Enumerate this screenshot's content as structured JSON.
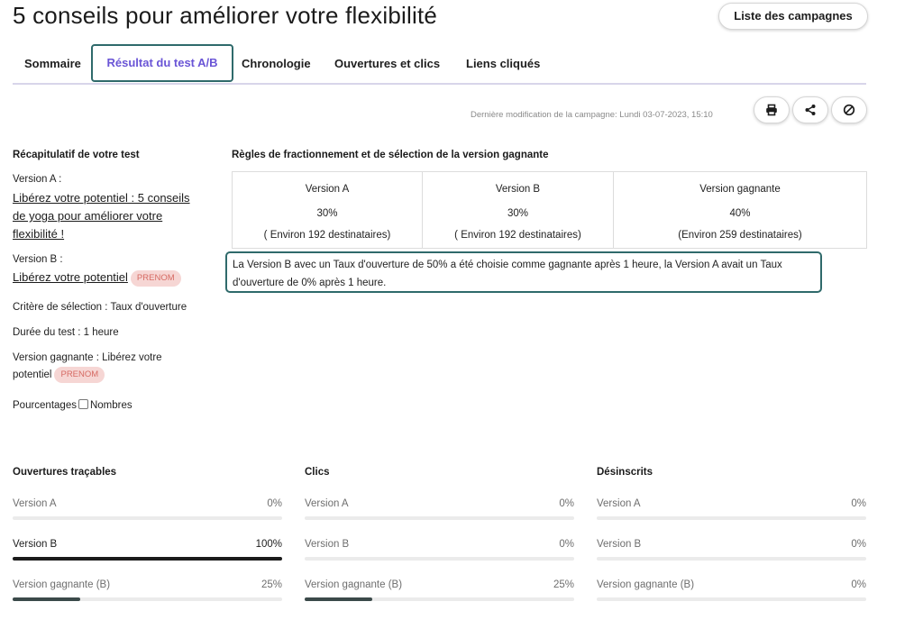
{
  "page": {
    "title": "5 conseils pour améliorer votre flexibilité",
    "campaigns_button": "Liste des campagnes"
  },
  "tabs": [
    {
      "label": "Sommaire",
      "active": false
    },
    {
      "label": "Résultat du test A/B",
      "active": true
    },
    {
      "label": "Chronologie",
      "active": false
    },
    {
      "label": "Ouvertures et clics",
      "active": false
    },
    {
      "label": "Liens cliqués",
      "active": false
    }
  ],
  "toolbar": {
    "last_modified_label": "Dernière modification de la campagne:",
    "last_modified_value": "Lundi 03-07-2023, 15:10",
    "icons": [
      "print-icon",
      "share-icon",
      "block-icon"
    ]
  },
  "summary": {
    "heading": "Récapitulatif de votre test",
    "version_a_label": "Version A :",
    "version_a_title_l1": "Libérez votre potentiel : 5 conseils",
    "version_a_title_l2": "de yoga pour améliorer votre",
    "version_a_title_l3": "flexibilité !",
    "version_b_label": "Version B :",
    "version_b_title": "Libérez votre potentiel",
    "badge": "PRENOM",
    "criteria": "Critère de sélection : Taux d'ouverture",
    "duration": "Durée du test : 1 heure",
    "winner_l1": "Version gagnante : Libérez votre",
    "winner_l2": "potentiel",
    "percentages_label": "Pourcentages",
    "numbers_label": "Nombres"
  },
  "rules": {
    "heading": "Règles de fractionnement et de sélection de la version gagnante",
    "columns": [
      {
        "name": "Version A",
        "percent": "30%",
        "recipients": "( Environ 192 destinataires)"
      },
      {
        "name": "Version B",
        "percent": "30%",
        "recipients": "( Environ 192 destinataires)"
      },
      {
        "name": "Version gagnante",
        "percent": "40%",
        "recipients": "(Environ 259 destinataires)"
      }
    ],
    "result_line1": "La Version B avec un Taux d'ouverture de 50% a été choisie comme gagnante après 1 heure, la Version A avait un Taux",
    "result_line2": "d'ouverture de 0% après 1 heure."
  },
  "stats": [
    {
      "heading": "Ouvertures traçables",
      "rows": [
        {
          "label": "Version A",
          "value": "0%",
          "fraction": 0.0
        },
        {
          "label": "Version B",
          "value": "100%",
          "fraction": 1.0
        },
        {
          "label": "Version gagnante (B)",
          "value": "25%",
          "fraction": 0.25
        }
      ]
    },
    {
      "heading": "Clics",
      "rows": [
        {
          "label": "Version A",
          "value": "0%",
          "fraction": 0.0
        },
        {
          "label": "Version B",
          "value": "0%",
          "fraction": 0.0
        },
        {
          "label": "Version gagnante (B)",
          "value": "25%",
          "fraction": 0.25
        }
      ]
    },
    {
      "heading": "Désinscrits",
      "rows": [
        {
          "label": "Version A",
          "value": "0%",
          "fraction": 0.0
        },
        {
          "label": "Version B",
          "value": "0%",
          "fraction": 0.0
        },
        {
          "label": "Version gagnante (B)",
          "value": "0%",
          "fraction": 0.0
        }
      ]
    }
  ],
  "colors": {
    "accent": "#6a55d6",
    "highlight_border": "#2f6a6b",
    "badge_bg": "#f6d6d4",
    "badge_text": "#d66a63"
  }
}
